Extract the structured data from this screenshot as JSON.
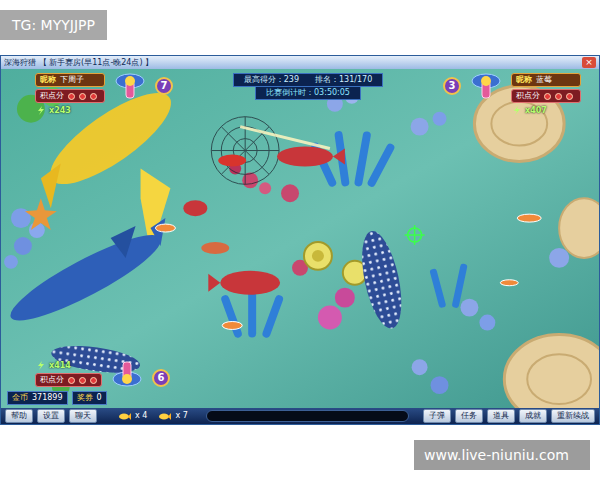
{
  "watermarks": [
    {
      "text": "TG: MYYJJPP"
    },
    {
      "text": "www.live-niuniu.com"
    }
  ],
  "window": {
    "title": "深海狩猎 【 新手赛房(早11点-晚24点) 】",
    "close": "×"
  },
  "scoreboard": {
    "best": "最高得分：239",
    "rank": "排名：131/170",
    "countdown": "比赛倒计时：03:50:05"
  },
  "players": [
    {
      "nickname_label": "昵称",
      "nickname": "下周子",
      "points_label": "积点分",
      "ammo": "x243",
      "seat": "7"
    },
    {
      "nickname_label": "昵称",
      "nickname": "蓝莓",
      "points_label": "积点分",
      "ammo": "x407",
      "seat": "3"
    },
    {
      "points_label": "积点分",
      "ammo": "x414",
      "seat": "6"
    }
  ],
  "wallet": {
    "coins_label": "金币",
    "coins": "371899",
    "tickets_label": "奖券",
    "tickets": "0"
  },
  "toolbar": {
    "left": [
      "帮助",
      "设置",
      "聊天"
    ],
    "multipliers": [
      "x 4",
      "x 7"
    ],
    "right": [
      "子弹",
      "任务",
      "道具",
      "成就",
      "重新续战"
    ]
  }
}
